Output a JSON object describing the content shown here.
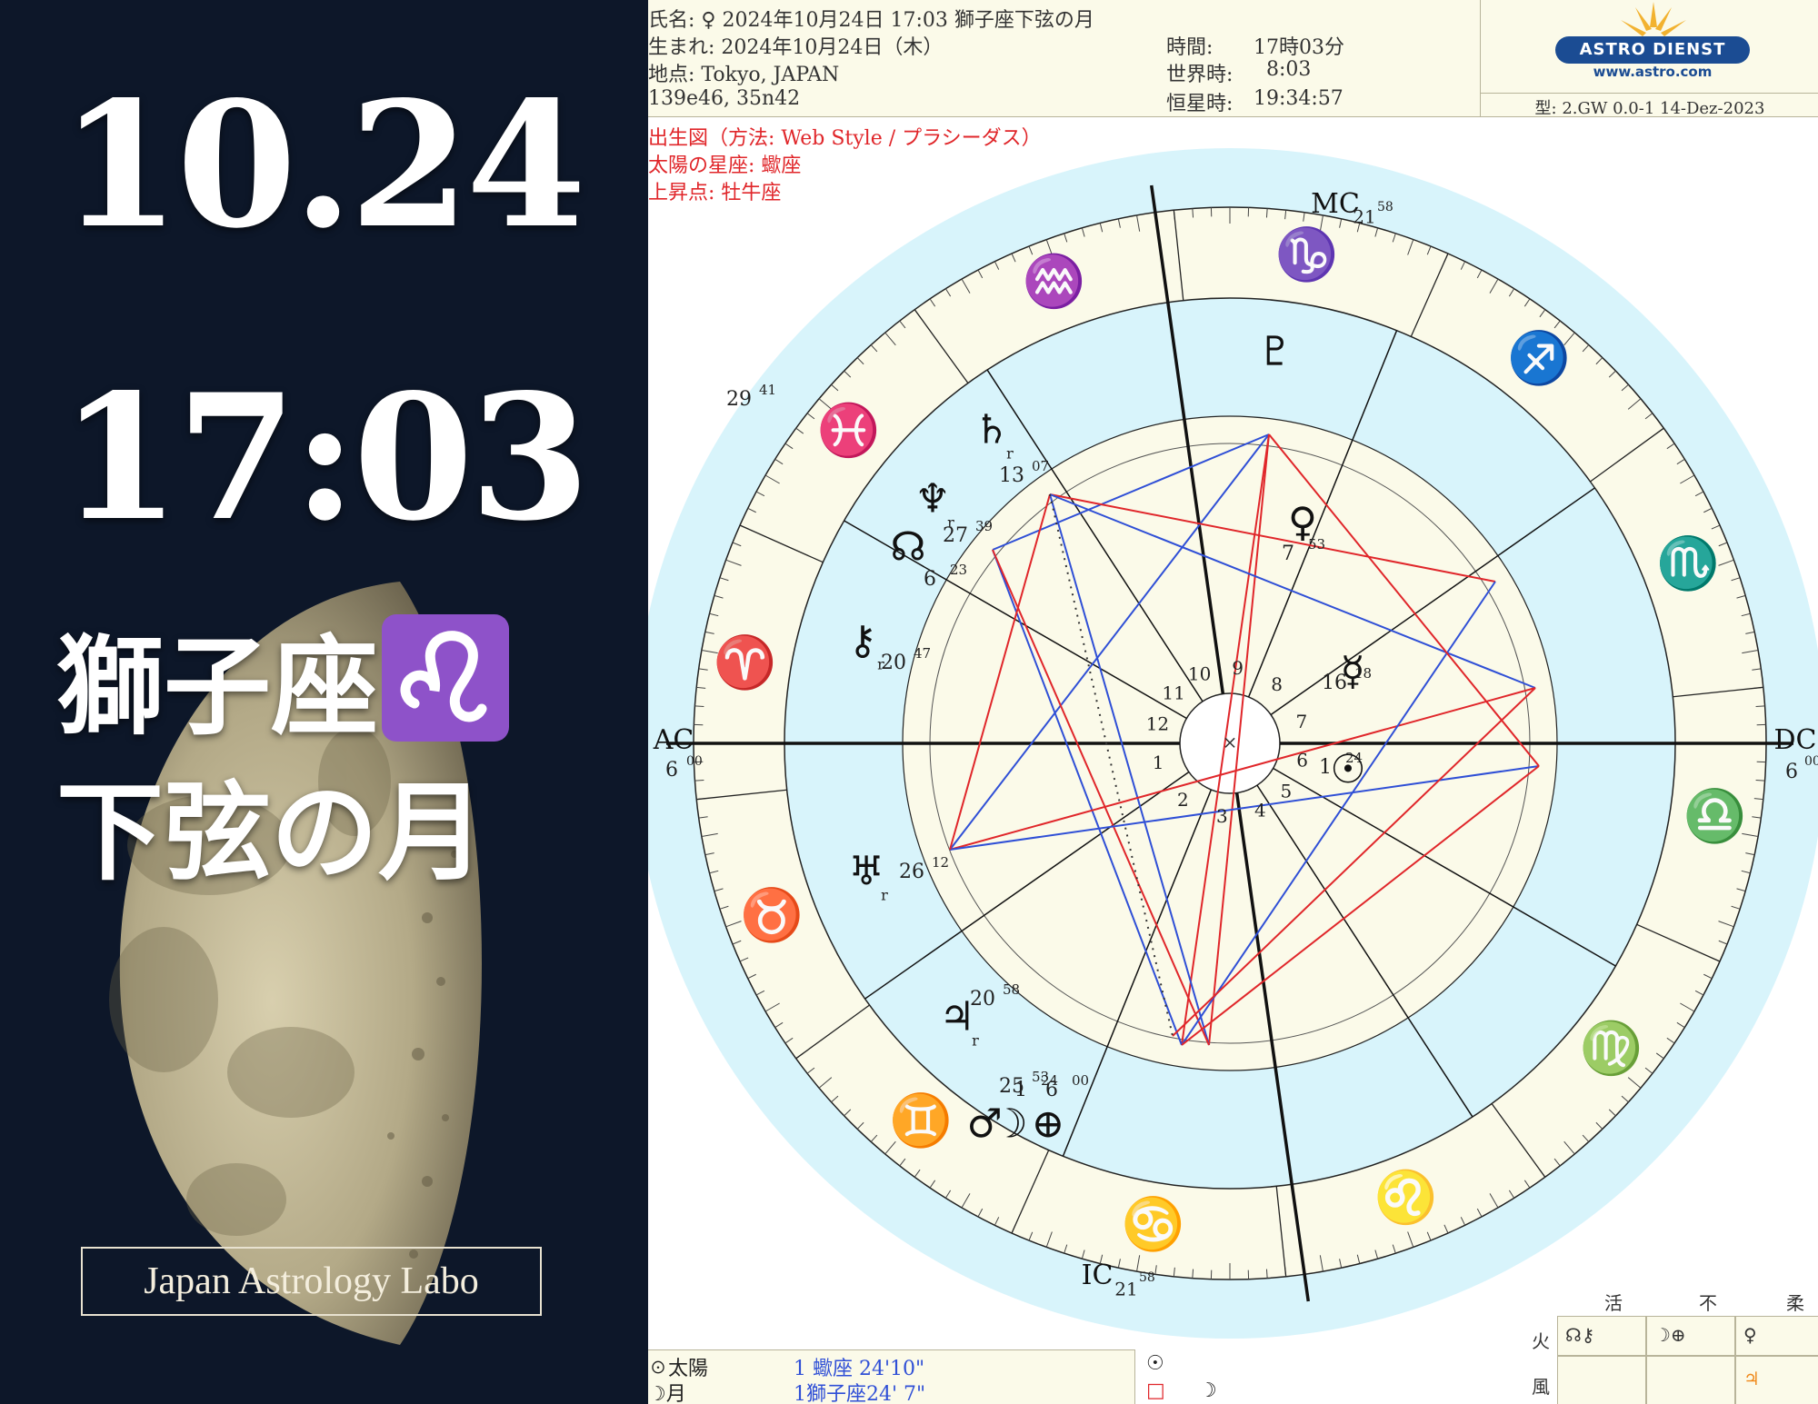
{
  "banner": {
    "date": "10.24",
    "time": "17:03",
    "sign": "獅子座",
    "phase": "下弦の月",
    "brand": "Japan Astrology Labo"
  },
  "header": {
    "name": "氏名: ♀ 2024年10月24日 17:03 獅子座下弦の月",
    "born": "生まれ: 2024年10月24日（木）",
    "place": "地点: Tokyo, JAPAN",
    "coords": "139e46, 35n42",
    "time_label": "時間:",
    "time_value": "17時03分",
    "ut_label": "世界時:",
    "ut_value": "8:03",
    "sidereal_label": "恒星時:",
    "sidereal_value": "19:34:57",
    "method": "出生図（方法: Web Style / プラシーダス）",
    "sun_sign": "太陽の星座: 蠍座",
    "ascendant": "上昇点: 牡牛座",
    "logo_text": "ASTRO DIENST",
    "logo_url": "www.astro.com",
    "chart_type": "型: 2.GW 0.0-1 14-Dez-2023"
  },
  "chart": {
    "ac": "AC",
    "ac_deg": "6",
    "ac_min": "00",
    "dc": "DC",
    "dc_deg": "6",
    "dc_min": "00",
    "mc": "MC",
    "mc_deg": "21",
    "mc_min": "58",
    "ic": "IC",
    "ic_deg": "21",
    "ic_min": "58",
    "houses": [
      "1",
      "2",
      "3",
      "4",
      "5",
      "6",
      "7",
      "8",
      "9",
      "10",
      "11",
      "12"
    ],
    "planets": [
      {
        "glyph": "♇",
        "deg": "29",
        "min": "41"
      },
      {
        "glyph": "♄",
        "deg": "13",
        "min": "07",
        "retro": "r"
      },
      {
        "glyph": "♆",
        "deg": "27",
        "min": "39",
        "retro": "r"
      },
      {
        "glyph": "☊",
        "deg": "6",
        "min": "23"
      },
      {
        "glyph": "⚷",
        "deg": "20",
        "min": "47",
        "retro": "r"
      },
      {
        "glyph": "♅",
        "deg": "26",
        "min": "12",
        "retro": "r"
      },
      {
        "glyph": "♃",
        "deg": "20",
        "min": "58",
        "retro": "r"
      },
      {
        "glyph": "♂",
        "deg": "25",
        "min": "53"
      },
      {
        "glyph": "☽",
        "deg": "1",
        "min": "24"
      },
      {
        "glyph": "⊕",
        "deg": "6",
        "min": "00"
      },
      {
        "glyph": "☉",
        "deg": "1",
        "min": "24"
      },
      {
        "glyph": "☿",
        "deg": "16",
        "min": "18"
      },
      {
        "glyph": "♀",
        "deg": "7",
        "min": "53"
      }
    ],
    "signs": [
      "♒",
      "♑",
      "♐",
      "♏",
      "♎",
      "♍",
      "♌",
      "♋",
      "♊",
      "♉",
      "♈",
      "♓"
    ],
    "colors": {
      "fire": "#e0262a",
      "earth": "#2aa92a",
      "air": "#f08a1c",
      "water": "#2850c8",
      "aspect_red": "#e0262a",
      "aspect_blue": "#2f4fd6",
      "ring_blue": "#d8f4fb",
      "ring_cream": "#fbfae9"
    }
  },
  "table": {
    "sun_row": "☉太陽",
    "sun_value": "1 蠍座 24'10\"",
    "moon_row": "☽月",
    "moon_value": "1獅子座24' 7\"",
    "col_icon": "☉"
  },
  "elements": {
    "headers": [
      "活",
      "不",
      "柔"
    ],
    "rows": [
      {
        "label": "火",
        "cells": [
          "☊⚷",
          "☽⊕",
          "♀"
        ]
      },
      {
        "label": "風",
        "cells": [
          "",
          "",
          "♃"
        ]
      }
    ]
  }
}
